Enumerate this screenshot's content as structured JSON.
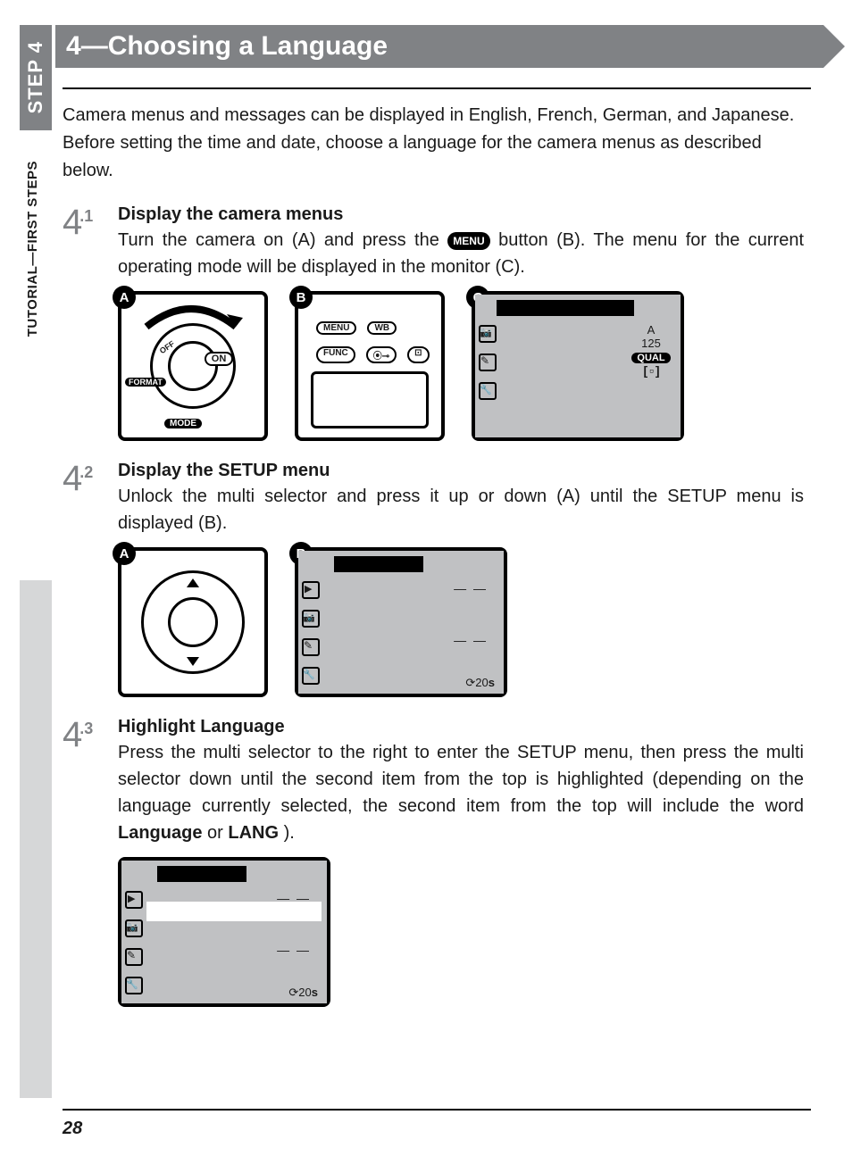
{
  "sidebar": {
    "step_tab": "STEP 4",
    "section_label": "TUTORIAL—FIRST STEPS"
  },
  "heading": {
    "number": "4",
    "dash": "—",
    "title": "Choosing a Language"
  },
  "intro": "Camera menus and messages can be displayed in English, French, German, and Japanese.  Before setting the time and date, choose a language for the camera menus as described below.",
  "steps": {
    "s1": {
      "num": "4",
      "sub": ".1",
      "title": "Display the camera menus",
      "text_before": "Turn the camera on (A) and press the ",
      "menu_label": "MENU",
      "text_after": " button (B).  The menu for the current operating mode will be displayed in the monitor (C).",
      "figA": {
        "label": "A",
        "on": "ON",
        "off": "OFF",
        "format": "FORMAT",
        "mode": "MODE"
      },
      "figB": {
        "label": "B",
        "b_menu": "MENU",
        "b_wb": "WB",
        "b_func": "FUNC",
        "b_play": "⦿⊸",
        "b_af": "⊡"
      },
      "figC": {
        "label": "C",
        "r1": "A",
        "r2": "125",
        "r3": "QUAL",
        "r4": "[ ▫ ]"
      }
    },
    "s2": {
      "num": "4",
      "sub": ".2",
      "title": "Display the SETUP menu",
      "text": "Unlock the multi selector and press it up or down (A) until the SETUP menu is displayed (B).",
      "figA": {
        "label": "A"
      },
      "figB": {
        "label": "B",
        "dash1": "— —",
        "dash2": "— —",
        "timer_icon": "⟳",
        "timer": "20",
        "timer_unit": "s"
      }
    },
    "s3": {
      "num": "4",
      "sub": ".3",
      "title": "Highlight Language",
      "text_a": "Press the multi selector to the right to enter the SETUP menu, then press the multi selector down until the second item from the top is highlighted (depending on the language currently selected, the second item from the top will include the word ",
      "bold1": "Language",
      "text_b": " or ",
      "bold2": "LANG",
      "text_c": ").",
      "fig": {
        "dash1": "— —",
        "dash2": "— —",
        "timer_icon": "⟳",
        "timer": "20",
        "timer_unit": "s"
      }
    }
  },
  "page_number": "28"
}
